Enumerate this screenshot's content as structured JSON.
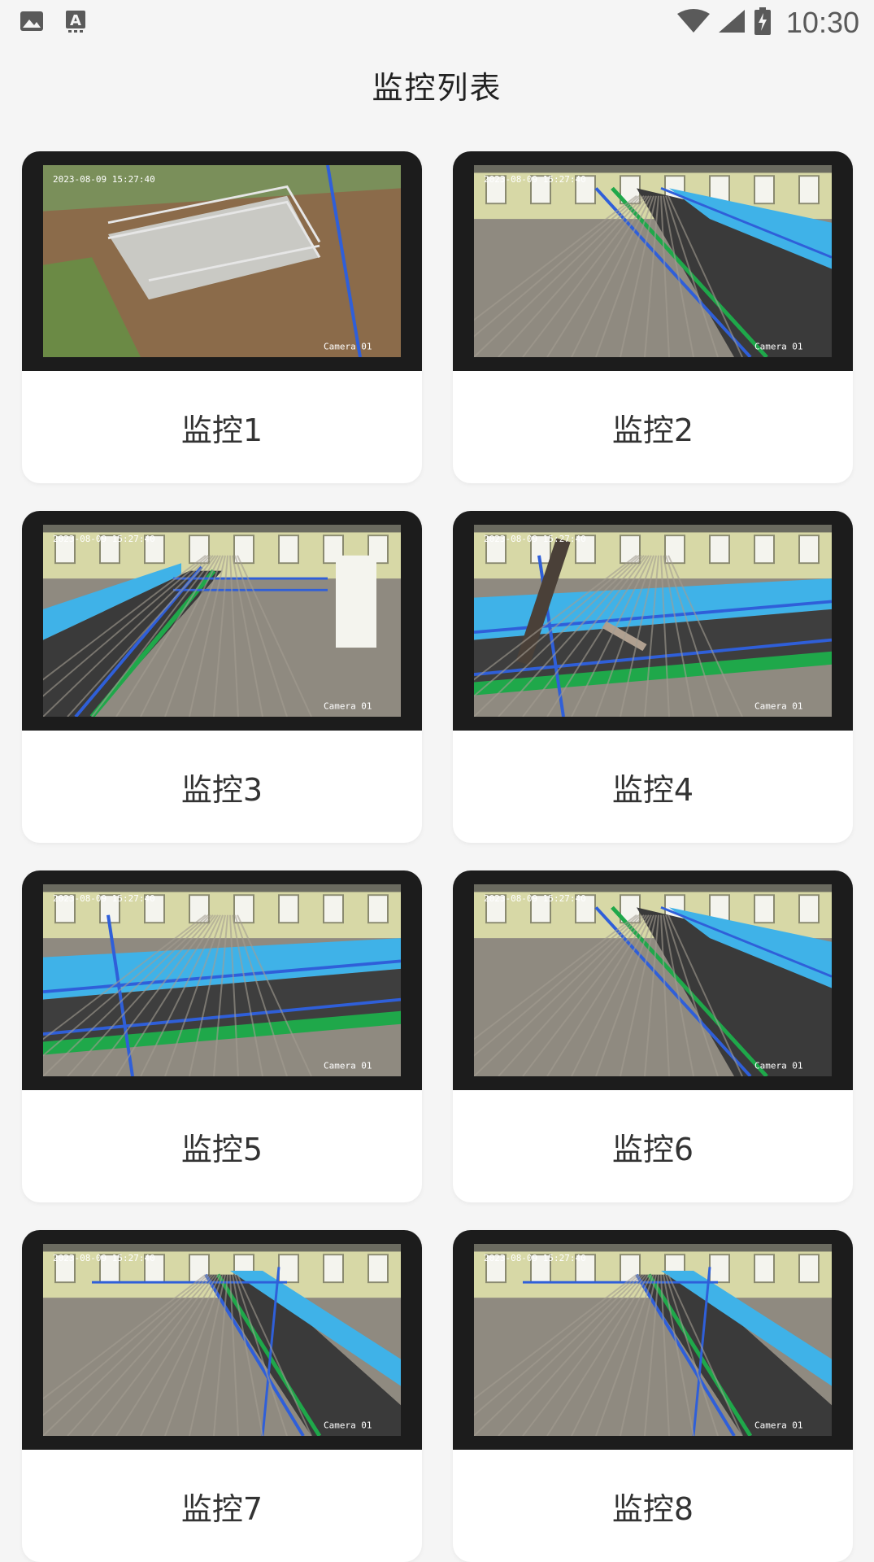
{
  "status_bar": {
    "left_icons": [
      "image-icon",
      "keyboard-a-icon"
    ],
    "right_icons": [
      "wifi-icon",
      "signal-icon",
      "battery-charging-icon"
    ],
    "time": "10:30"
  },
  "app_bar": {
    "title": "监控列表"
  },
  "cameras": [
    {
      "label": "监控1",
      "scene": "outdoor"
    },
    {
      "label": "监控2",
      "scene": "barn-right"
    },
    {
      "label": "监控3",
      "scene": "barn-left"
    },
    {
      "label": "监控4",
      "scene": "barn-pipe"
    },
    {
      "label": "监控5",
      "scene": "barn-wide"
    },
    {
      "label": "监控6",
      "scene": "barn-right"
    },
    {
      "label": "监控7",
      "scene": "barn-long"
    },
    {
      "label": "监控8",
      "scene": "barn-long"
    }
  ],
  "colors": {
    "background": "#f5f5f5",
    "card": "#ffffff",
    "frame": "#1c1c1c",
    "rail_blue": "#2f5fd9",
    "trough_cyan": "#3fb2e8",
    "rail_green": "#1fa84a",
    "wall": "#d7d8a6",
    "floor": "#8f8a80",
    "soil": "#8b6b4a"
  }
}
